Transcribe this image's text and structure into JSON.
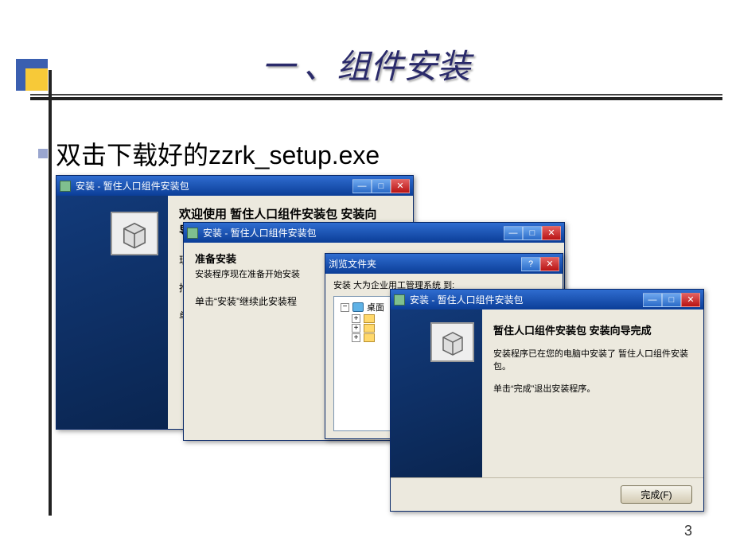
{
  "slide": {
    "title": "一 、组件安装",
    "bullet": "双击下载好的zzrk_setup.exe",
    "page_number": "3"
  },
  "win1": {
    "title": "安装 - 暂住人口组件安装包",
    "heading_prefix": "欢迎使用  暂住人口组件安装包  安装向",
    "heading_suffix": "导",
    "line1": "现",
    "line2": "推",
    "line3": "单"
  },
  "win2": {
    "title": "安装 - 暂住人口组件安装包",
    "section_heading": "准备安装",
    "section_sub": "安装程序现在准备开始安装",
    "body": "单击“安装”继续此安装程"
  },
  "win3": {
    "title": "浏览文件夹",
    "body": "安装 大为企业用工管理系统 到:",
    "tree_root": "桌面",
    "exp_plus1": "+",
    "exp_plus2": "+",
    "exp_plus3": "+"
  },
  "win4": {
    "title": "安装 - 暂住人口组件安装包",
    "heading": "暂住人口组件安装包 安装向导完成",
    "p1": "安装程序已在您的电脑中安装了 暂住人口组件安装包。",
    "p2": "单击“完成”退出安装程序。",
    "finish_btn": "完成(F)"
  },
  "icons": {
    "minimize": "—",
    "maximize": "□",
    "close": "✕",
    "help": "?"
  }
}
